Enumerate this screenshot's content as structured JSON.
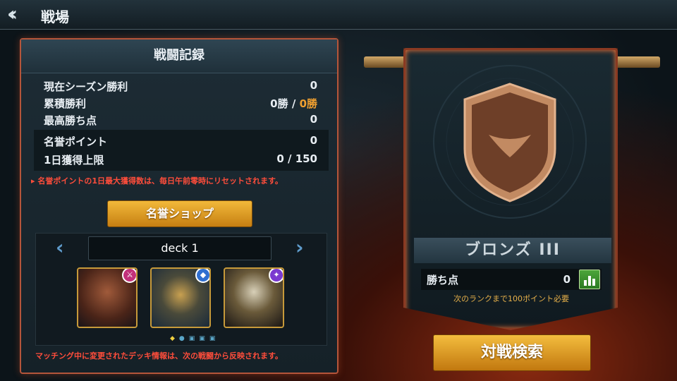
{
  "header": {
    "title": "戦場"
  },
  "record": {
    "title": "戦闘記録",
    "season_wins_label": "現在シーズン勝利",
    "season_wins_value": "0",
    "total_wins_label": "累積勝利",
    "total_wins_value": "0勝",
    "total_wins_sep": "/",
    "total_wins_value2": "0勝",
    "best_score_label": "最高勝ち点",
    "best_score_value": "0",
    "honor_label": "名誉ポイント",
    "honor_value": "0",
    "daily_label": "1日獲得上限",
    "daily_value": "0 / 150",
    "honor_note": "▸ 名誉ポイントの1日最大獲得数は、毎日午前零時にリセットされます。"
  },
  "shop": {
    "label": "名誉ショップ"
  },
  "deck": {
    "name": "deck 1",
    "cards": [
      {
        "badge": "sword-icon",
        "badge_color": "#c2307a"
      },
      {
        "badge": "shield-icon",
        "badge_color": "#2f6fd0"
      },
      {
        "badge": "magic-icon",
        "badge_color": "#7a3ad0"
      }
    ],
    "note": "マッチング中に変更されたデッキ情報は、次の戦闘から反映されます。"
  },
  "rank": {
    "name": "ブロンズ III",
    "points_label": "勝ち点",
    "points_value": "0",
    "note": "次のランクまで100ポイント必要"
  },
  "search": {
    "label": "対戦検索"
  },
  "colors": {
    "accent_gold": "#e9a92c",
    "note_red": "#ff4d3b",
    "orange_wins": "#f0a030"
  }
}
